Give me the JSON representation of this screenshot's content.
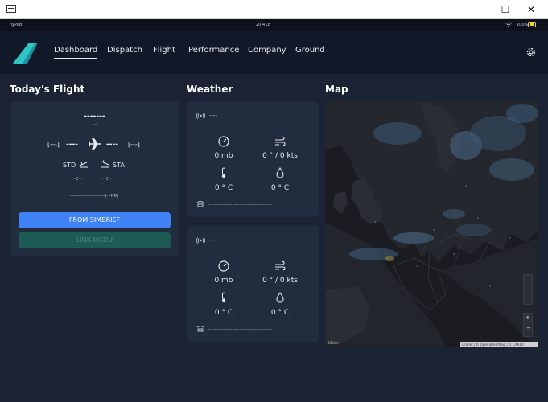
{
  "window": {
    "minimize_glyph": "—",
    "maximize_glyph": "☐",
    "close_glyph": "✕"
  },
  "statusbar": {
    "left_text": "flyPad",
    "time": "20:41z",
    "battery_percent": "100%"
  },
  "nav": {
    "items": [
      {
        "label": "Dashboard",
        "active": true
      },
      {
        "label": "Dispatch"
      },
      {
        "label": "Flight"
      },
      {
        "label": "Performance"
      },
      {
        "label": "Company"
      },
      {
        "label": "Ground"
      }
    ],
    "settings_icon": "gear-icon",
    "accent_color": "#2ec4c4"
  },
  "todays_flight": {
    "title": "Today's Flight",
    "flight_number": "-------",
    "airline_subtext": "---",
    "origin": "[---]",
    "origin_dashes": "----",
    "destination_dashes": "----",
    "destination": "[---]",
    "std_label": "STD",
    "sta_label": "STA",
    "std_time": "--:--",
    "sta_time": "--:--",
    "route_distance": "------------------------|---NM|",
    "simbrief_button": "FROM SIMBRIEF",
    "link_mcdu_button": "LINK MCDU"
  },
  "weather": {
    "title": "Weather",
    "panels": [
      {
        "station": "----",
        "pressure": "0 mb",
        "wind": "0 ° / 0 kts",
        "temperature": "0 ° C",
        "dewpoint": "0 ° C",
        "metar": "-------------------------------------"
      },
      {
        "station": "----",
        "pressure": "0 mb",
        "wind": "0 ° / 0 kts",
        "temperature": "0 ° C",
        "dewpoint": "0 ° C",
        "metar": "-------------------------------------"
      }
    ]
  },
  "map": {
    "title": "Map",
    "scale_label": "300km",
    "attribution": "Leaflet | © OpenStreetMap | © CARTO"
  }
}
